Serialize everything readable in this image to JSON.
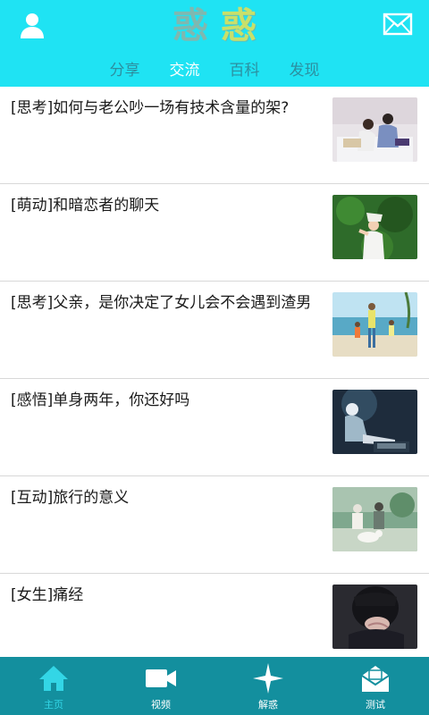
{
  "header": {
    "logo_left": "惑",
    "logo_right": "惑",
    "tabs": [
      {
        "label": "分享",
        "active": false
      },
      {
        "label": "交流",
        "active": true
      },
      {
        "label": "百科",
        "active": false
      },
      {
        "label": "发现",
        "active": false
      }
    ],
    "user_icon": "user-icon",
    "mail_icon": "mail-icon"
  },
  "articles": [
    {
      "title": "[思考]如何与老公吵一场有技术含量的架?",
      "thumb": "couple-on-bed-photo"
    },
    {
      "title": "[萌动]和暗恋者的聊天",
      "thumb": "girl-in-forest-photo"
    },
    {
      "title": "[思考]父亲，是你决定了女儿会不会遇到渣男",
      "thumb": "family-on-beach-photo"
    },
    {
      "title": "[感悟]单身两年，你还好吗",
      "thumb": "woman-sitting-photo"
    },
    {
      "title": "[互动]旅行的意义",
      "thumb": "people-with-dog-photo"
    },
    {
      "title": "[女生]痛经",
      "thumb": "girl-hugging-knees-photo"
    }
  ],
  "bottom_nav": [
    {
      "label": "主页",
      "icon": "home-icon",
      "active": true
    },
    {
      "label": "视频",
      "icon": "video-camera-icon",
      "active": false
    },
    {
      "label": "解惑",
      "icon": "star-compass-icon",
      "active": false
    },
    {
      "label": "测试",
      "icon": "envelope-icon",
      "active": false
    }
  ],
  "colors": {
    "header_bg": "#1fe3f3",
    "nav_bg": "#138f9e",
    "active_nav_label": "#33d6e6",
    "inactive_tab": "#2c8fa0"
  }
}
